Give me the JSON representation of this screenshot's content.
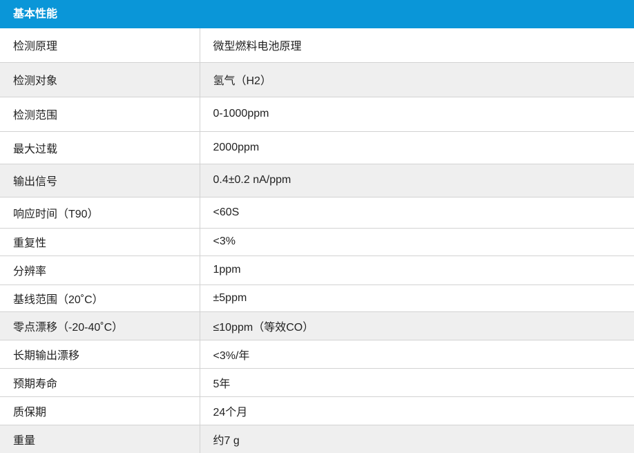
{
  "header": {
    "title": "基本性能"
  },
  "rows": [
    {
      "label": "检测原理",
      "value": "微型燃料电池原理"
    },
    {
      "label": "检测对象",
      "value": "氢气（H2）"
    },
    {
      "label": "检测范围",
      "value": "0-1000ppm"
    },
    {
      "label": "最大过载",
      "value": "2000ppm"
    },
    {
      "label": "输出信号",
      "value": "0.4±0.2 nA/ppm"
    },
    {
      "label": "响应时间（T90）",
      "value": "<60S"
    },
    {
      "label": "重复性",
      "value": "<3%"
    },
    {
      "label": "分辨率",
      "value": "1ppm"
    },
    {
      "label": "基线范围（20˚C）",
      "value": "±5ppm"
    },
    {
      "label": "零点漂移（-20-40˚C）",
      "value": "≤10ppm（等效CO）"
    },
    {
      "label": "长期输出漂移",
      "value": "<3%/年"
    },
    {
      "label": "预期寿命",
      "value": "5年"
    },
    {
      "label": "质保期",
      "value": "24个月"
    },
    {
      "label": "重量",
      "value": "约7 g"
    }
  ],
  "colors": {
    "header": "#0a96d8",
    "alt_row": "#efefef",
    "border": "#d2d2d2"
  }
}
